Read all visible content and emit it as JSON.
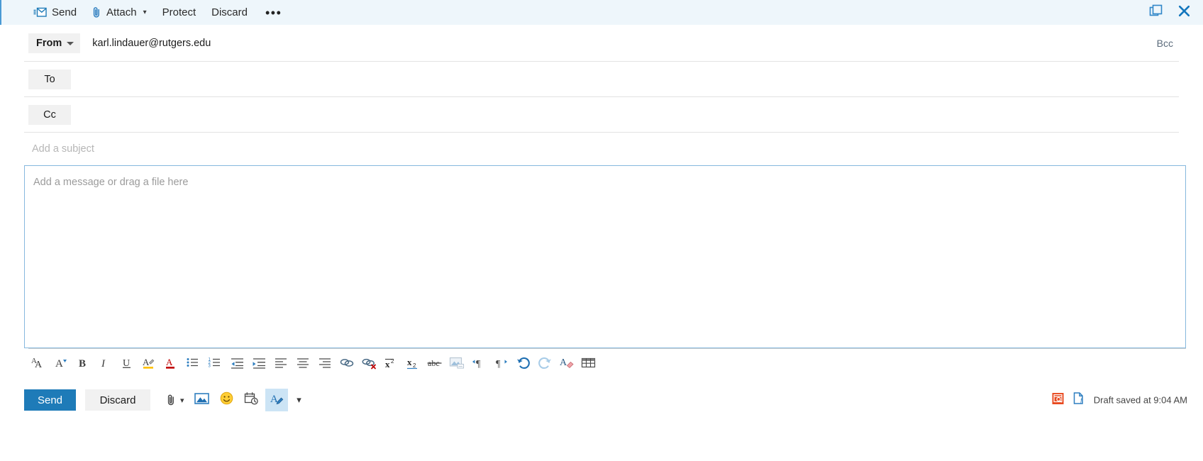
{
  "commandbar": {
    "items": [
      {
        "label": "Send",
        "icon": "send-mail-icon",
        "chevron": false
      },
      {
        "label": "Attach",
        "icon": "paperclip-icon",
        "chevron": true
      },
      {
        "label": "Protect",
        "icon": "",
        "chevron": false
      },
      {
        "label": "Discard",
        "icon": "",
        "chevron": false
      }
    ],
    "overflow_label": "•••",
    "window_controls": [
      {
        "name": "pop-out-icon"
      },
      {
        "name": "close-icon"
      }
    ]
  },
  "compose": {
    "from": {
      "label": "From",
      "address": "karl.lindauer@rutgers.edu"
    },
    "bcc_label": "Bcc",
    "to": {
      "label": "To",
      "value": ""
    },
    "cc": {
      "label": "Cc",
      "value": ""
    },
    "subject": {
      "value": "",
      "placeholder": "Add a subject"
    },
    "body": {
      "value": "",
      "placeholder": "Add a message or drag a file here"
    }
  },
  "format_toolbar": {
    "buttons": [
      {
        "name": "font-size-icon",
        "title": "Font size"
      },
      {
        "name": "font-family-icon",
        "title": "Font"
      },
      {
        "name": "bold-icon",
        "title": "Bold"
      },
      {
        "name": "italic-icon",
        "title": "Italic"
      },
      {
        "name": "underline-icon",
        "title": "Underline"
      },
      {
        "name": "highlight-icon",
        "title": "Highlight"
      },
      {
        "name": "font-color-icon",
        "title": "Font color"
      },
      {
        "name": "bulleted-list-icon",
        "title": "Bulleted list"
      },
      {
        "name": "numbered-list-icon",
        "title": "Numbered list"
      },
      {
        "name": "decrease-indent-icon",
        "title": "Decrease indent"
      },
      {
        "name": "increase-indent-icon",
        "title": "Increase indent"
      },
      {
        "name": "align-left-icon",
        "title": "Align left"
      },
      {
        "name": "align-center-icon",
        "title": "Align center"
      },
      {
        "name": "align-right-icon",
        "title": "Align right"
      },
      {
        "name": "insert-link-icon",
        "title": "Insert link"
      },
      {
        "name": "remove-link-icon",
        "title": "Remove link"
      },
      {
        "name": "superscript-icon",
        "title": "Superscript"
      },
      {
        "name": "subscript-icon",
        "title": "Subscript"
      },
      {
        "name": "strikethrough-icon",
        "title": "Strikethrough"
      },
      {
        "name": "insert-picture-icon",
        "title": "Insert inline picture"
      },
      {
        "name": "ltr-paragraph-icon",
        "title": "Left-to-right"
      },
      {
        "name": "rtl-paragraph-icon",
        "title": "Right-to-left"
      },
      {
        "name": "undo-icon",
        "title": "Undo"
      },
      {
        "name": "redo-icon",
        "title": "Redo"
      },
      {
        "name": "clear-formatting-icon",
        "title": "Clear formatting"
      },
      {
        "name": "insert-table-icon",
        "title": "Insert table"
      }
    ]
  },
  "bottombar": {
    "send_label": "Send",
    "discard_label": "Discard",
    "actions": [
      {
        "name": "attach-file-icon",
        "title": "Attach"
      },
      {
        "name": "insert-picture-icon",
        "title": "Insert pictures inline"
      },
      {
        "name": "emoji-icon",
        "title": "Emoji"
      },
      {
        "name": "poll-calendar-icon",
        "title": "Suggested meeting times"
      },
      {
        "name": "formatting-options-icon",
        "title": "Formatting options",
        "active": true
      },
      {
        "name": "more-options-chevron-icon",
        "title": "More options"
      }
    ],
    "status": {
      "text": "Draft saved at 9:04 AM",
      "icons": [
        {
          "name": "addin-icon"
        },
        {
          "name": "file-addin-icon"
        }
      ]
    }
  },
  "colors": {
    "accent": "#1e7bb8",
    "header_bg": "#eef6fb",
    "body_border": "#86b8de"
  }
}
